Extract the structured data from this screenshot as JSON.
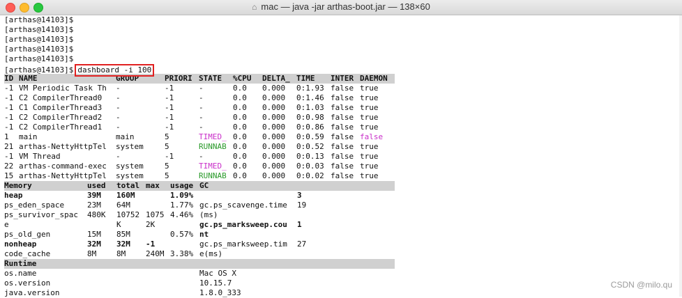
{
  "window": {
    "title": "mac — java -jar arthas-boot.jar — 138×60"
  },
  "prompts": [
    "[arthas@14103]$",
    "[arthas@14103]$",
    "[arthas@14103]$",
    "[arthas@14103]$",
    "[arthas@14103]$"
  ],
  "command_line": {
    "prompt": "[arthas@14103]$",
    "command": "dashboard -i 100"
  },
  "threads": {
    "headers": [
      "ID",
      "NAME",
      "GROUP",
      "PRIORI",
      "STATE",
      "%CPU",
      "DELTA_",
      "TIME",
      "INTER",
      "DAEMON"
    ],
    "rows": [
      [
        "-1",
        "VM Periodic Task Th",
        "-",
        "-1",
        "-",
        "0.0",
        "0.000",
        "0:1.93",
        "false",
        "true"
      ],
      [
        "-1",
        "C2 CompilerThread0",
        "-",
        "-1",
        "-",
        "0.0",
        "0.000",
        "0:1.46",
        "false",
        "true"
      ],
      [
        "-1",
        "C1 CompilerThread3",
        "-",
        "-1",
        "-",
        "0.0",
        "0.000",
        "0:1.03",
        "false",
        "true"
      ],
      [
        "-1",
        "C2 CompilerThread2",
        "-",
        "-1",
        "-",
        "0.0",
        "0.000",
        "0:0.98",
        "false",
        "true"
      ],
      [
        "-1",
        "C2 CompilerThread1",
        "-",
        "-1",
        "-",
        "0.0",
        "0.000",
        "0:0.86",
        "false",
        "true"
      ],
      [
        "1",
        "main",
        "main",
        "5",
        "TIMED_",
        "0.0",
        "0.000",
        "0:0.59",
        "false",
        "false"
      ],
      [
        "21",
        "arthas-NettyHttpTel",
        "system",
        "5",
        "RUNNAB",
        "0.0",
        "0.000",
        "0:0.52",
        "false",
        "true"
      ],
      [
        "-1",
        "VM Thread",
        "-",
        "-1",
        "-",
        "0.0",
        "0.000",
        "0:0.13",
        "false",
        "true"
      ],
      [
        "22",
        "arthas-command-exec",
        "system",
        "5",
        "TIMED_",
        "0.0",
        "0.000",
        "0:0.03",
        "false",
        "true"
      ],
      [
        "15",
        "arthas-NettyHttpTel",
        "system",
        "5",
        "RUNNAB",
        "0.0",
        "0.000",
        "0:0.02",
        "false",
        "true"
      ]
    ]
  },
  "memory": {
    "headers": [
      "Memory",
      "used",
      "total",
      "max",
      "usage",
      "GC",
      ""
    ],
    "rows": [
      [
        "heap",
        "39M",
        "160M",
        "",
        "1.09%",
        "",
        "3"
      ],
      [
        "ps_eden_space",
        "23M",
        "64M",
        "",
        "1.77%",
        "gc.ps_scavenge.time",
        "19"
      ],
      [
        "ps_survivor_spac",
        "480K",
        "10752",
        "1075",
        "4.46%",
        "(ms)",
        ""
      ],
      [
        "e",
        "",
        "K",
        "2K",
        "",
        "gc.ps_marksweep.cou",
        "1"
      ],
      [
        "ps_old_gen",
        "15M",
        "85M",
        "",
        "0.57%",
        "nt",
        ""
      ],
      [
        "nonheap",
        "32M",
        "32M",
        "-1",
        "",
        "gc.ps_marksweep.tim",
        "27"
      ],
      [
        "code_cache",
        "8M",
        "8M",
        "240M",
        "3.38%",
        "e(ms)",
        ""
      ]
    ]
  },
  "runtime": {
    "header": "Runtime",
    "rows": [
      [
        "os.name",
        "Mac OS X"
      ],
      [
        "os.version",
        "10.15.7"
      ],
      [
        "java.version",
        "1.8.0_333"
      ]
    ]
  },
  "watermark": "CSDN @milo.qu",
  "colors": {
    "timed": "#c92ec9",
    "runnable": "#2a9a2a",
    "highlight_box": "#e02020",
    "header_bg": "#d0d0d0"
  }
}
